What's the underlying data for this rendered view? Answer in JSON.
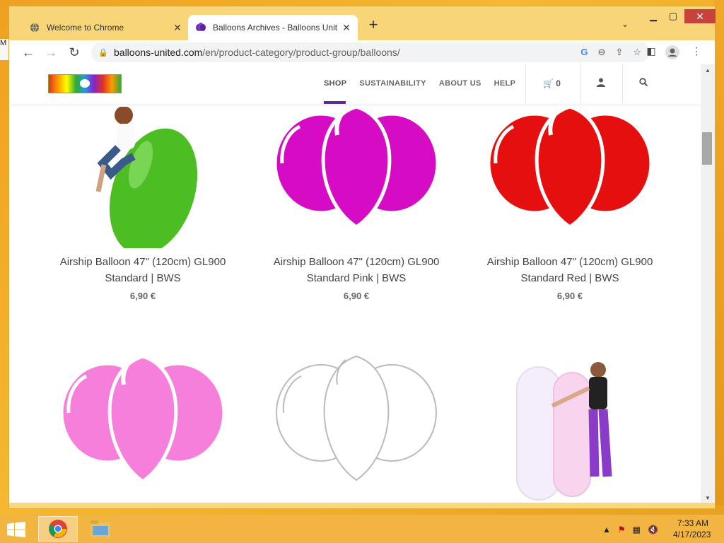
{
  "browser": {
    "tabs": [
      {
        "title": "Welcome to Chrome"
      },
      {
        "title": "Balloons Archives - Balloons Unit"
      }
    ],
    "url_host": "balloons-united.com",
    "url_path": "/en/product-category/product-group/balloons/"
  },
  "site": {
    "menu": [
      "SHOP",
      "SUSTAINABILITY",
      "ABOUT US",
      "HELP"
    ],
    "cart_count": "0"
  },
  "products": [
    {
      "name": "Airship Balloon 47\" (120cm) GL900 Standard | BWS",
      "price": "6,90 €",
      "color": "#4cbd22",
      "image": "green-airship-with-woman"
    },
    {
      "name": "Airship Balloon 47\" (120cm) GL900 Standard Pink | BWS",
      "price": "6,90 €",
      "color": "#d60bc4",
      "image": "magenta-balloons"
    },
    {
      "name": "Airship Balloon 47\" (120cm) GL900 Standard Red | BWS",
      "price": "6,90 €",
      "color": "#e60f0f",
      "image": "red-balloons"
    },
    {
      "name": "",
      "price": "",
      "color": "#f77fdc",
      "image": "pink-balloons"
    },
    {
      "name": "",
      "price": "",
      "color": "#ffffff",
      "image": "white-outline-balloons"
    },
    {
      "name": "",
      "price": "",
      "color": "#f0d0f0",
      "image": "long-balloons-with-woman"
    }
  ],
  "taskbar": {
    "time": "7:33 AM",
    "date": "4/17/2023"
  },
  "desktop": {
    "sliver_text": "M"
  }
}
